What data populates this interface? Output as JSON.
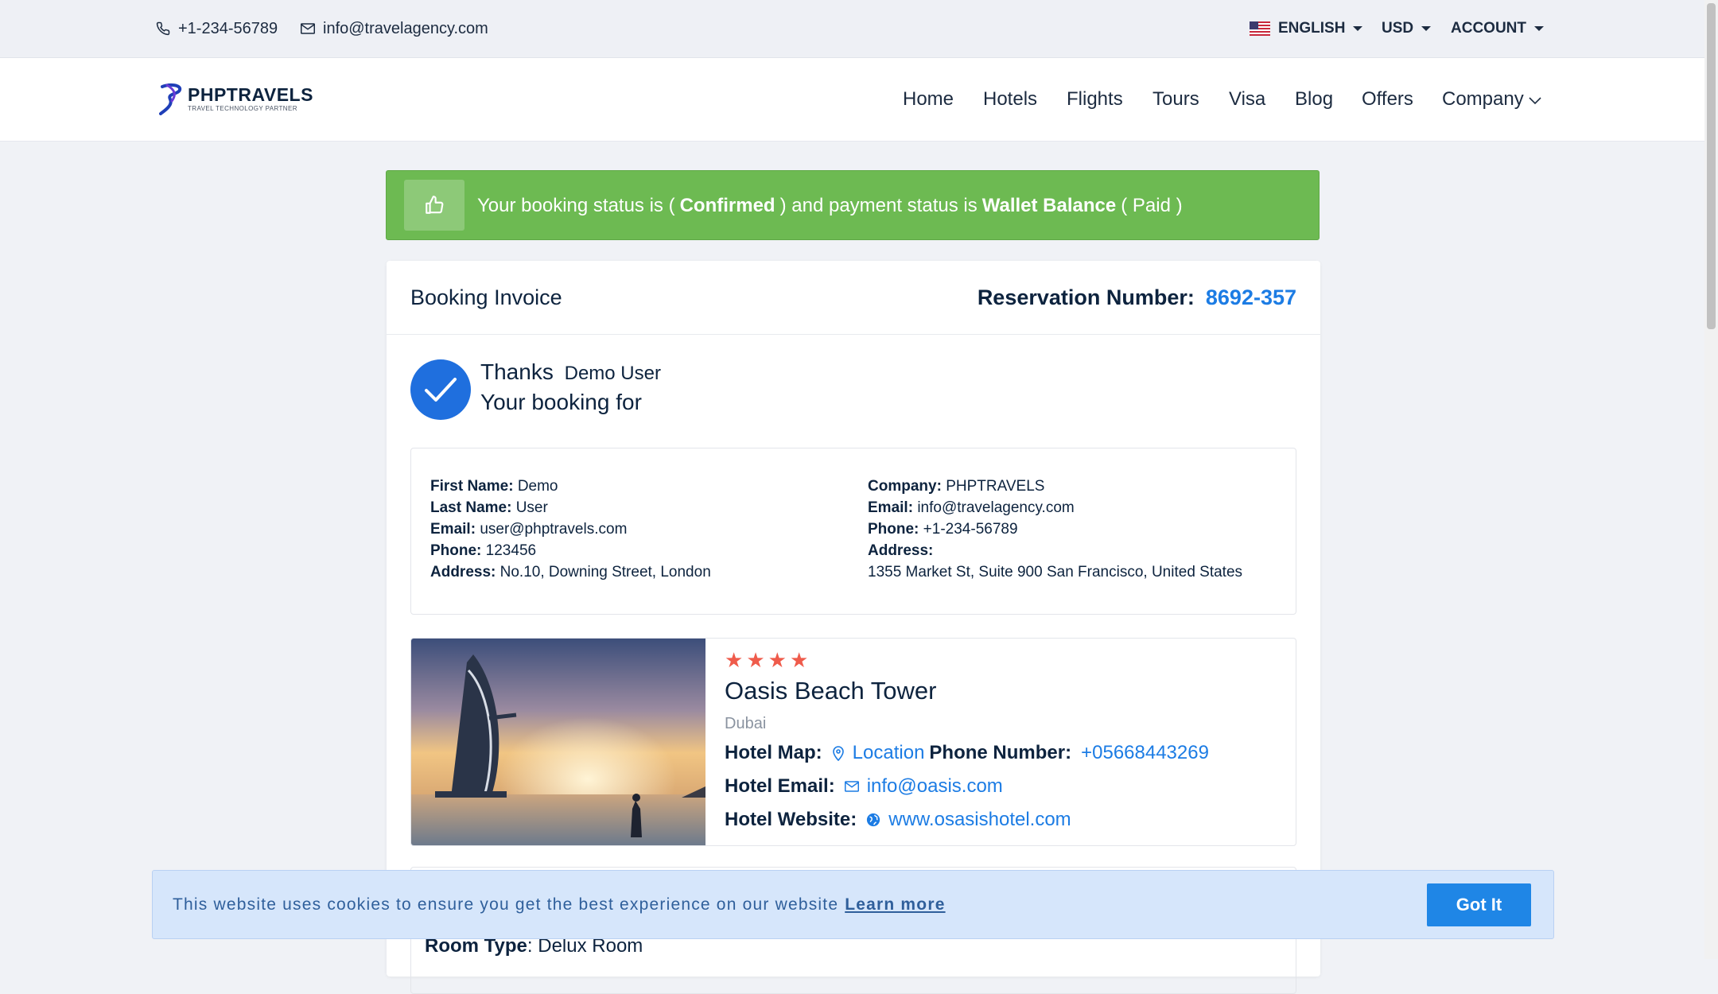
{
  "topbar": {
    "phone": "+1-234-56789",
    "email": "info@travelagency.com",
    "language": "ENGLISH",
    "currency": "USD",
    "account": "ACCOUNT"
  },
  "brand": {
    "name": "PHPTRAVELS",
    "tagline": "TRAVEL TECHNOLOGY PARTNER"
  },
  "nav": {
    "items": [
      "Home",
      "Hotels",
      "Flights",
      "Tours",
      "Visa",
      "Blog",
      "Offers",
      "Company"
    ]
  },
  "alert": {
    "prefix": "Your booking status is (",
    "booking_status": "Confirmed",
    "middle": ") and payment status is",
    "payment_method": "Wallet Balance",
    "payment_status": "( Paid )"
  },
  "invoice": {
    "title": "Booking Invoice",
    "reservation_label": "Reservation Number:",
    "reservation_number": "8692-357",
    "thanks": "Thanks",
    "user_name": "Demo User",
    "booking_for": "Your booking for"
  },
  "customer": {
    "first_name_label": "First Name:",
    "first_name": "Demo",
    "last_name_label": "Last Name:",
    "last_name": "User",
    "email_label": "Email:",
    "email": "user@phptravels.com",
    "phone_label": "Phone:",
    "phone": "123456",
    "address_label": "Address:",
    "address": "No.10, Downing Street, London"
  },
  "company": {
    "company_label": "Company:",
    "company": "PHPTRAVELS",
    "email_label": "Email:",
    "email": "info@travelagency.com",
    "phone_label": "Phone:",
    "phone": "+1-234-56789",
    "address_label": "Address:",
    "address": "1355 Market St, Suite 900 San Francisco, United States"
  },
  "hotel": {
    "stars": 4,
    "name": "Oasis Beach Tower",
    "city": "Dubai",
    "map_label": "Hotel Map:",
    "map_link": "Location",
    "phone_label": "Phone Number:",
    "phone": "+05668443269",
    "email_label": "Hotel Email:",
    "email": "info@oasis.com",
    "website_label": "Hotel Website:",
    "website": "www.osasishotel.com"
  },
  "room": {
    "type_label": "Room Type",
    "type": "Delux Room"
  },
  "cookie": {
    "text": "This website uses cookies to ensure you get the best experience on our website",
    "learn_more": "Learn more",
    "button": "Got It"
  },
  "colors": {
    "success": "#6dba52",
    "link": "#1c7ce4",
    "star": "#ef5b4b",
    "primary_button": "#1f86e6"
  }
}
